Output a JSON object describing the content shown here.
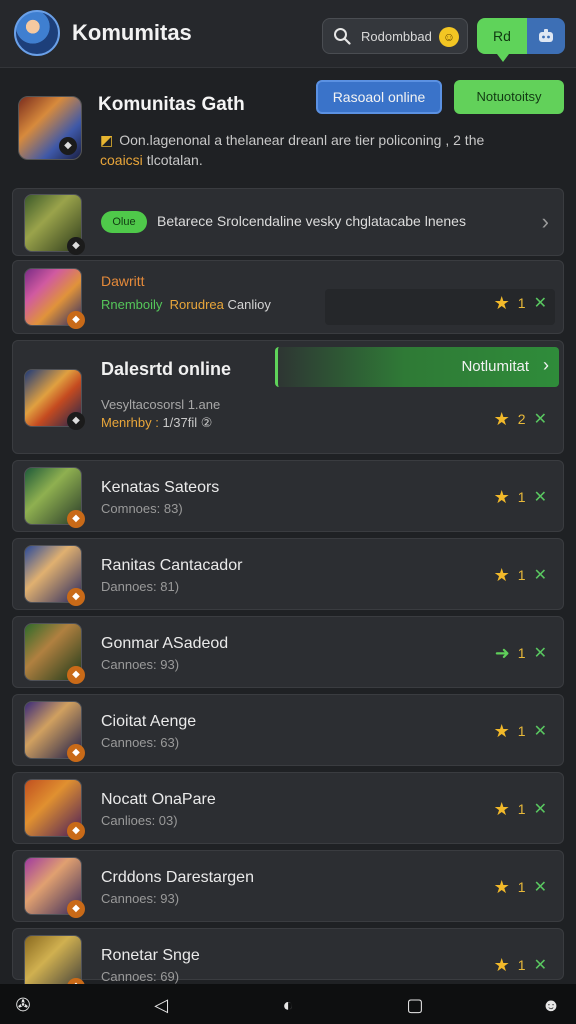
{
  "header": {
    "title": "Komumitas",
    "search_text": "Rodombbad",
    "btn_green": "Rd",
    "icons": [
      "avatar",
      "search-icon",
      "emoji-icon",
      "chat-bot-icon"
    ]
  },
  "community": {
    "title": "Komunitas Gath",
    "btn_blue": "Rasoaol online",
    "btn_green": "Notuotoitsy",
    "desc_main": "Oon.lagenonal a thelanear dreanl are tier policoning , 2 the",
    "desc_accent": "coaicsi",
    "desc_rest": "tlcotalan."
  },
  "notice": {
    "tag": "Olue",
    "text": "Betarece Srolcendaline vesky chglatacabe lnenes"
  },
  "featured": {
    "name": "Dawritt",
    "tag1": "Rnemboily",
    "tag2": "Rorudrea",
    "tag3": "Canlioy",
    "count": "1"
  },
  "expanded": {
    "title": "Dalesrtd online",
    "line1": "Vesyltacosorsl 1.ane",
    "line2_accent": "Menrhby :",
    "line2_rest": "1/37fil ②",
    "cta": "Notlumitat",
    "count": "2"
  },
  "rows": [
    {
      "title": "Kenatas Sateors",
      "sub": "Comnoes: 83)",
      "count": "1",
      "icon": "star"
    },
    {
      "title": "Ranitas Cantacador",
      "sub": "Dannoes: 81)",
      "count": "1",
      "icon": "star"
    },
    {
      "title": "Gonmar ASadeod",
      "sub": "Cannoes: 93)",
      "count": "1",
      "icon": "arrow"
    },
    {
      "title": "Cioitat Aenge",
      "sub": "Cannoes: 63)",
      "count": "1",
      "icon": "star"
    },
    {
      "title": "Nocatt OnaPare",
      "sub": "Canlioes: 03)",
      "count": "1",
      "icon": "star"
    },
    {
      "title": "Crddons Darestargen",
      "sub": "Cannoes: 93)",
      "count": "1",
      "icon": "star"
    },
    {
      "title": "Ronetar Snge",
      "sub": "Cannoes: 69)",
      "count": "1",
      "icon": "star"
    }
  ],
  "nav": [
    "browser-icon",
    "back-icon",
    "home-icon",
    "recents-icon",
    "assistant-icon"
  ],
  "colors": {
    "accent_green": "#5fd35a",
    "accent_blue": "#3a73c9",
    "accent_orange": "#e9a63a",
    "star": "#f2b92a",
    "background": "#1f2124"
  }
}
